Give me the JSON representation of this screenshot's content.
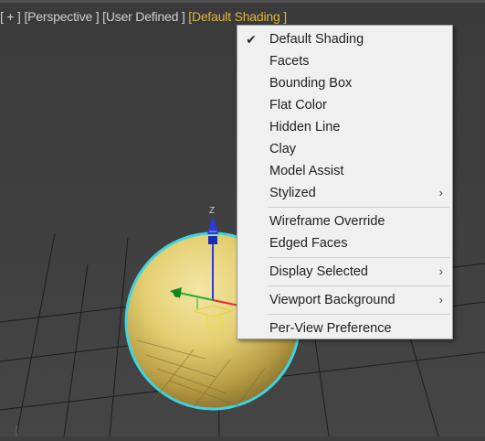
{
  "viewport": {
    "labels": [
      "[ + ]",
      "[Perspective ]",
      "[User Defined ]",
      "[Default Shading ]"
    ],
    "active_label": "Default Shading",
    "axis_label": "Z",
    "colors": {
      "background": "#3e3e3e",
      "active_label": "#e0b43b",
      "selection_outline": "#3fd4e0",
      "sphere": "#e3cf72"
    }
  },
  "context_menu": {
    "groups": [
      [
        {
          "label": "Default Shading",
          "checked": true
        },
        {
          "label": "Facets"
        },
        {
          "label": "Bounding Box"
        },
        {
          "label": "Flat Color"
        },
        {
          "label": "Hidden Line"
        },
        {
          "label": "Clay"
        },
        {
          "label": "Model Assist"
        },
        {
          "label": "Stylized",
          "submenu": true
        }
      ],
      [
        {
          "label": "Wireframe Override"
        },
        {
          "label": "Edged Faces"
        }
      ],
      [
        {
          "label": "Display Selected",
          "submenu": true
        }
      ],
      [
        {
          "label": "Viewport Background",
          "submenu": true
        }
      ],
      [
        {
          "label": "Per-View Preference"
        }
      ]
    ],
    "check_icon": "checkmark-icon",
    "submenu_icon": "chevron-right-icon"
  }
}
